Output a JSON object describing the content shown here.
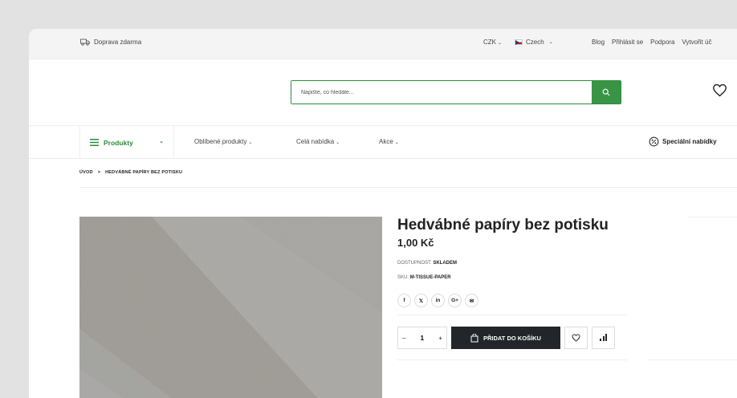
{
  "topbar": {
    "shipping": "Doprava zdarma",
    "currency": "CZK",
    "language": "Czech",
    "links": [
      "Blog",
      "Přihlásit se",
      "Podpora",
      "Vytvořit úč"
    ]
  },
  "search": {
    "placeholder": "Napište, co hledáte..."
  },
  "nav": {
    "products": "Produkty",
    "items": [
      "Oblíbené produkty",
      "Celá nabídka",
      "Akce"
    ],
    "special": "Speciální nabídky"
  },
  "breadcrumb": {
    "home": "ÚVOD",
    "separator": ">",
    "current": "HEDVÁBNÉ PAPÍRY BEZ POTISKU"
  },
  "product": {
    "title": "Hedvábné papíry bez potisku",
    "price": "1,00 Kč",
    "availability_label": "DOSTUPNOST:",
    "availability_value": "SKLADEM",
    "sku_label": "SKU:",
    "sku_value": "M-TISSUE-PAPER",
    "social": [
      "f",
      "𝕏",
      "in",
      "G+",
      "✉"
    ],
    "qty_minus": "–",
    "qty": "1",
    "qty_plus": "+",
    "add_to_cart": "PŘIDAT DO KOŠÍKU"
  },
  "colors": {
    "accent": "#3a9446",
    "dark": "#222529"
  }
}
